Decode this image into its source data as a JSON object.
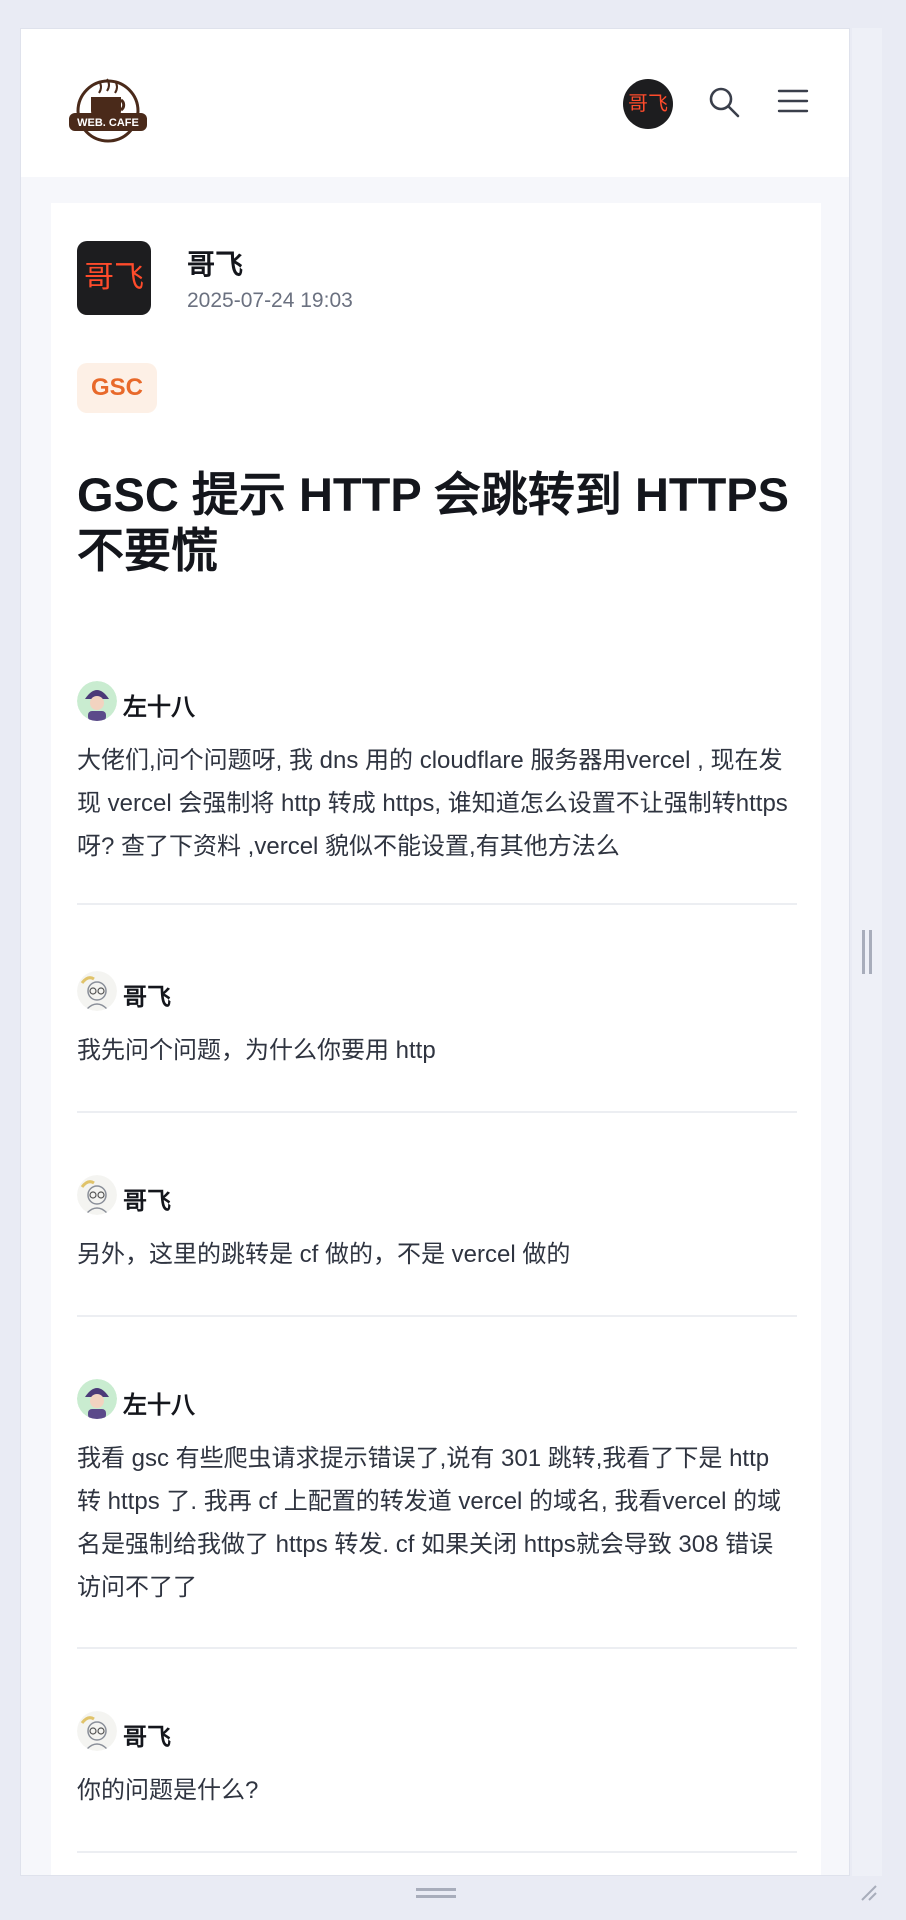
{
  "header": {
    "logo_text": "WEB. CAFE",
    "user_avatar_text": "哥飞"
  },
  "post": {
    "author": {
      "name": "哥飞",
      "avatar_text": "哥飞",
      "time": "2025-07-24 19:03"
    },
    "tag": "GSC",
    "title": "GSC 提示 HTTP 会跳转到 HTTPS 不要慌"
  },
  "replies": [
    {
      "author": "左十八",
      "avatar": "avatar-purple-hat-icon",
      "text": "大佬们,问个问题呀, 我 dns 用的 cloudflare 服务器用vercel , 现在发现 vercel 会强制将 http 转成 https, 谁知道怎么设置不让强制转https 呀? 查了下资料 ,vercel 貌似不能设置,有其他方法么"
    },
    {
      "author": "哥飞",
      "avatar": "avatar-glasses-icon",
      "text": "我先问个问题，为什么你要用 http"
    },
    {
      "author": "哥飞",
      "avatar": "avatar-glasses-icon",
      "text": "另外，这里的跳转是 cf 做的，不是 vercel 做的"
    },
    {
      "author": "左十八",
      "avatar": "avatar-purple-hat-icon",
      "text": "我看 gsc 有些爬虫请求提示错误了,说有 301 跳转,我看了下是 http 转 https 了. 我再 cf 上配置的转发道 vercel 的域名, 我看vercel 的域名是强制给我做了 https 转发. cf 如果关闭 https就会导致 308 错误访问不了了"
    },
    {
      "author": "哥飞",
      "avatar": "avatar-glasses-icon",
      "text": "你的问题是什么?"
    }
  ],
  "colors": {
    "accent": "#e8692a",
    "tag_bg": "#fdf0e6",
    "avatar_bg": "#1d1d1f",
    "avatar_text": "#ff4b2b"
  }
}
